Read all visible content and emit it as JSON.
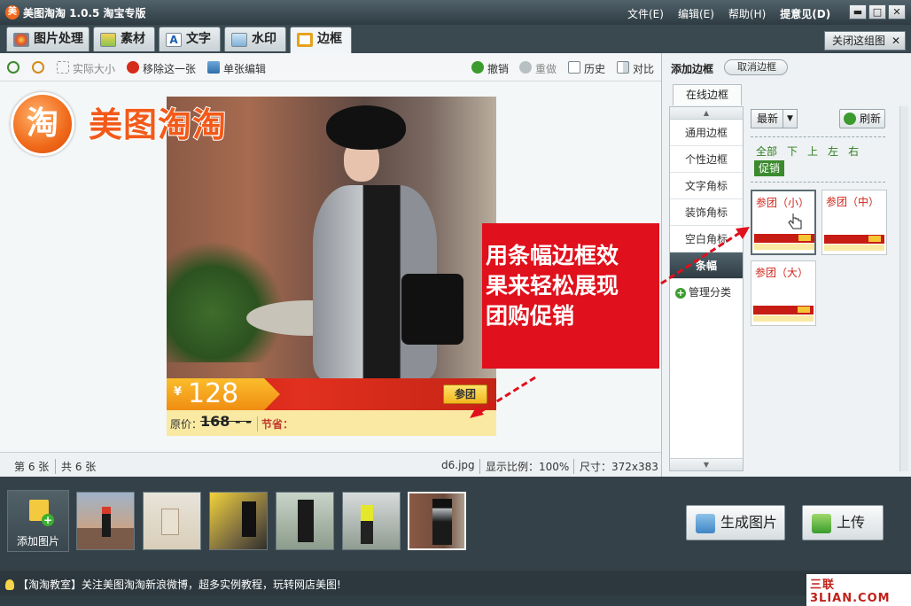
{
  "app": {
    "logo_char": "美",
    "title": "美图淘淘 1.0.5 淘宝专版"
  },
  "menu": {
    "file": "文件(E)",
    "edit": "编辑(E)",
    "help": "帮助(H)",
    "feedback": "提意见(D)"
  },
  "window_buttons": {
    "minimize": "▬",
    "maximize": "□",
    "close": "✕"
  },
  "tabs": [
    {
      "label": "图片处理"
    },
    {
      "label": "素材"
    },
    {
      "label": "文字"
    },
    {
      "label": "水印"
    },
    {
      "label": "边框"
    }
  ],
  "close_group": {
    "label": "关闭这组图",
    "x": "✕"
  },
  "toolbar": {
    "zoom_in": "",
    "zoom_out": "",
    "actual_size": "实际大小",
    "remove_one": "移除这一张",
    "single_edit": "单张编辑",
    "undo": "撤销",
    "redo": "重做",
    "history": "历史",
    "compare": "对比"
  },
  "canvas": {
    "logo_char": "淘",
    "logo_text": "美图淘淘",
    "banner": {
      "yen": "¥",
      "price": "128",
      "group_button": "参团"
    },
    "pricebar": {
      "orig_label": "原价：",
      "orig_price": "168 - -",
      "save_label": "节省："
    },
    "callout": [
      "用条幅边框效",
      "果来轻松展现",
      "团购促销"
    ]
  },
  "status": {
    "page": "第 6 张",
    "total": "共 6 张",
    "file": "d6.jpg",
    "zoom": "显示比例：100%",
    "size": "尺寸：372x383"
  },
  "right_panel": {
    "title": "添加边框",
    "cancel": "取消边框",
    "online_tab": "在线边框",
    "categories": [
      "通用边框",
      "个性边框",
      "文字角标",
      "装饰角标",
      "空白角标",
      "条幅"
    ],
    "manage": "管理分类",
    "sort": "最新",
    "refresh": "刷新",
    "filters": [
      "全部",
      "下",
      "上",
      "左",
      "右"
    ],
    "filter_promo": "促销",
    "thumbs": [
      {
        "title": "参团（小）"
      },
      {
        "title": "参团（中）"
      },
      {
        "title": "参团（大）"
      }
    ]
  },
  "filmstrip": {
    "add_label": "添加图片"
  },
  "actions": {
    "generate": "生成图片",
    "upload": "上传"
  },
  "footer": {
    "tip": "【淘淘教室】关注美图淘淘新浪微博，超多实例教程，玩转网店美图!",
    "watermark": "三联 3LIAN.COM"
  },
  "colors": {
    "accent_red": "#e0101c",
    "banner_red": "#c31b13",
    "price_orange": "#f08d12",
    "dark_chrome": "#2f3d44"
  }
}
